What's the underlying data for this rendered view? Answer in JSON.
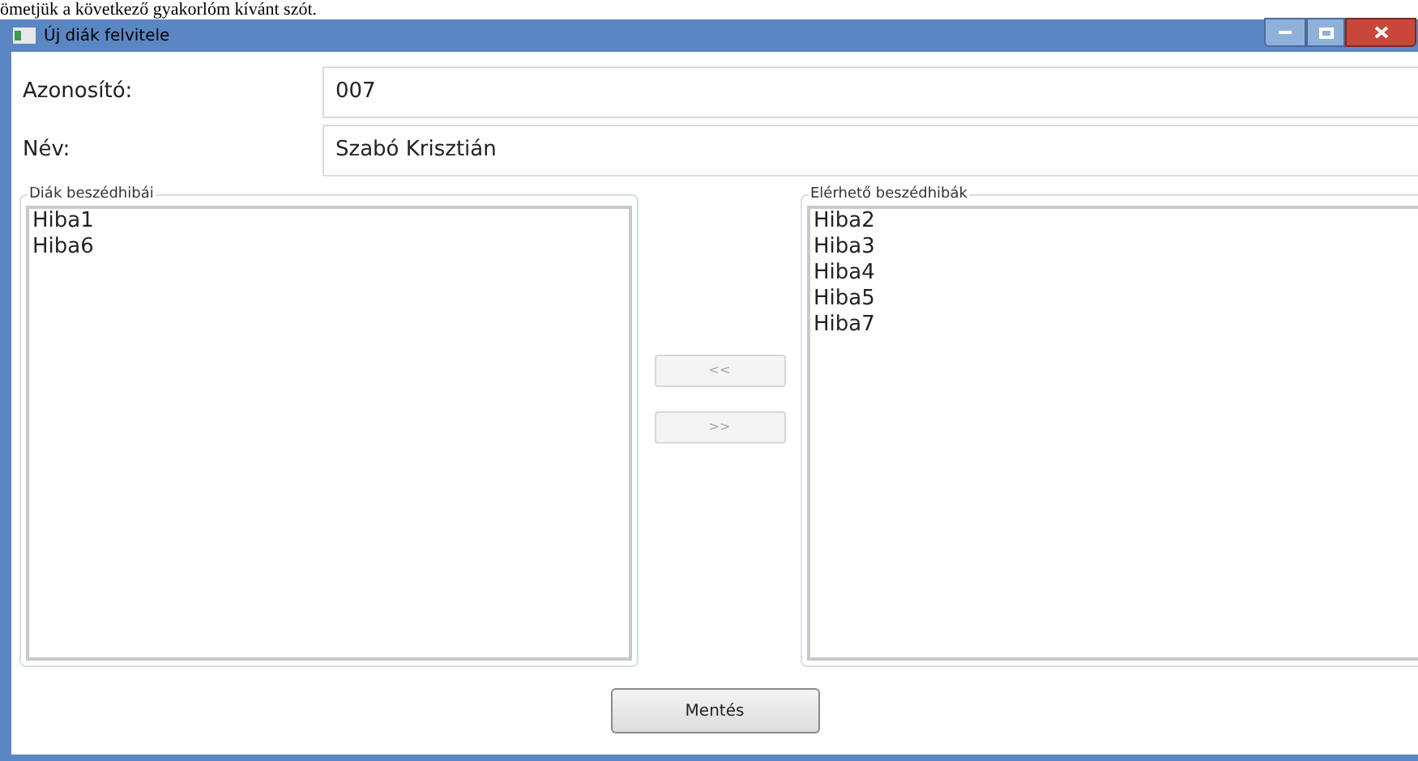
{
  "document_text": "ömetjük a következő gyakorlóm kívánt szót.",
  "window": {
    "title": "Új diák felvitele"
  },
  "fields": [
    {
      "label": "Azonosító:",
      "value": "007"
    },
    {
      "label": "Név:",
      "value": "Szabó Krisztián"
    }
  ],
  "student_errors": {
    "title": "Diák beszédhibái",
    "items": [
      "Hiba1",
      "Hiba6"
    ]
  },
  "available_errors": {
    "title": "Elérhető beszédhibák",
    "items": [
      "Hiba2",
      "Hiba3",
      "Hiba4",
      "Hiba5",
      "Hiba7"
    ]
  },
  "move_buttons": [
    {
      "label": "<<",
      "disabled": true
    },
    {
      "label": ">>",
      "disabled": true
    }
  ],
  "save_button": {
    "label": "Mentés"
  }
}
